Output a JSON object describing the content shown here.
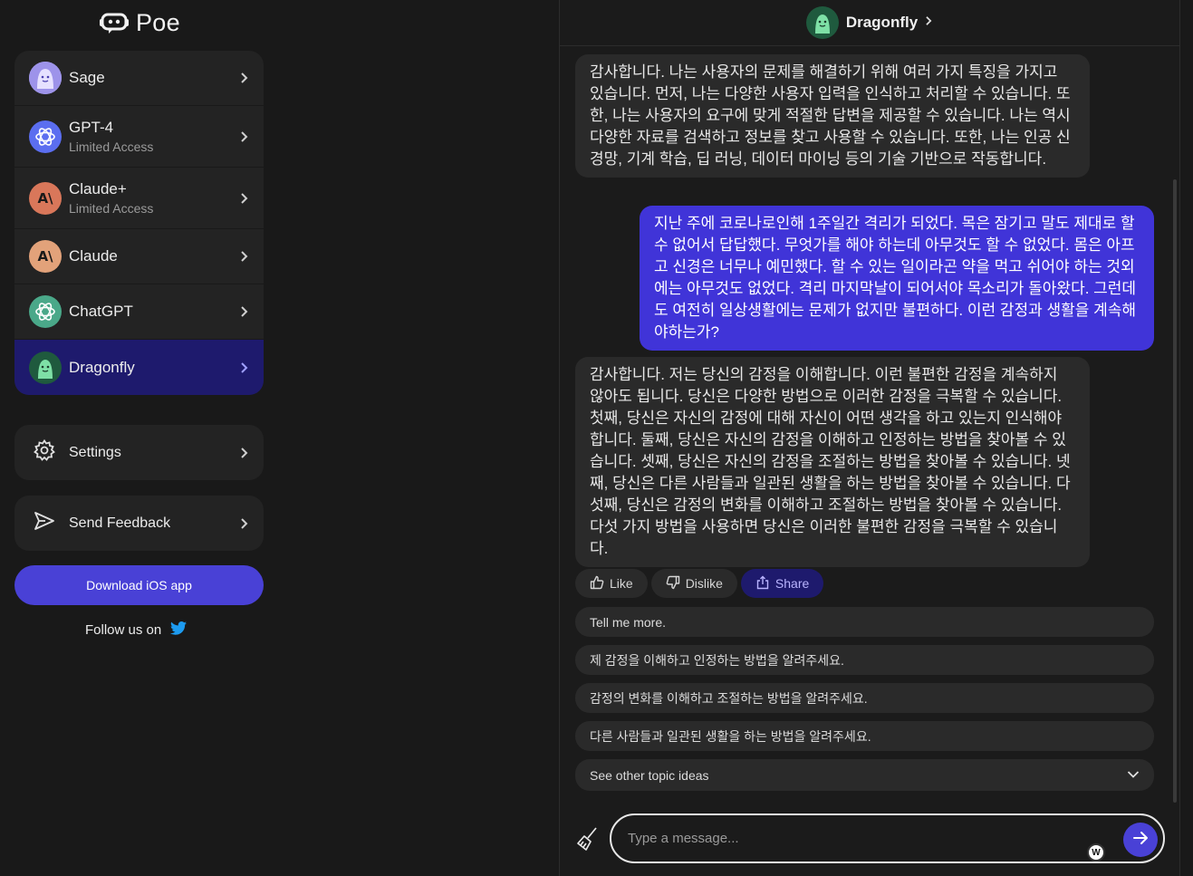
{
  "app": {
    "name": "Poe"
  },
  "sidebar": {
    "bots": [
      {
        "name": "Sage",
        "sub": ""
      },
      {
        "name": "GPT-4",
        "sub": "Limited Access"
      },
      {
        "name": "Claude+",
        "sub": "Limited Access"
      },
      {
        "name": "Claude",
        "sub": ""
      },
      {
        "name": "ChatGPT",
        "sub": ""
      },
      {
        "name": "Dragonfly",
        "sub": ""
      }
    ],
    "settings_label": "Settings",
    "feedback_label": "Send Feedback",
    "download_label": "Download iOS app",
    "follow_label": "Follow us on"
  },
  "chat": {
    "bot_name": "Dragonfly",
    "messages": [
      {
        "role": "bot",
        "text": "감사합니다. 나는 사용자의 문제를 해결하기 위해 여러 가지 특징을 가지고 있습니다. 먼저, 나는 다양한 사용자 입력을 인식하고 처리할 수 있습니다. 또한, 나는 사용자의 요구에 맞게 적절한 답변을 제공할 수 있습니다. 나는 역시 다양한 자료를 검색하고 정보를 찾고 사용할 수 있습니다. 또한, 나는 인공 신경망, 기계 학습, 딥 러닝, 데이터 마이닝 등의 기술 기반으로 작동합니다."
      },
      {
        "role": "user",
        "text": "지난 주에 코로나로인해 1주일간 격리가 되었다. 목은 잠기고 말도 제대로 할 수 없어서 답답했다. 무엇가를 해야 하는데 아무것도 할 수 없었다. 몸은 아프고 신경은 너무나 예민했다. 할 수 있는 일이라곤 약을 먹고 쉬어야 하는 것외에는 아무것도 없었다. 격리 마지막날이 되어서야 목소리가 돌아왔다. 그런데도 여전히 일상생활에는 문제가 없지만 불편하다. 이런 감정과 생활을 계속해야하는가?"
      },
      {
        "role": "bot",
        "text": "감사합니다. 저는 당신의 감정을 이해합니다. 이런 불편한 감정을 계속하지 않아도 됩니다. 당신은 다양한 방법으로 이러한 감정을 극복할 수 있습니다. 첫째, 당신은 자신의 감정에 대해 자신이 어떤 생각을 하고 있는지 인식해야 합니다. 둘째, 당신은 자신의 감정을 이해하고 인정하는 방법을 찾아볼 수 있습니다. 셋째, 당신은 자신의 감정을 조절하는 방법을 찾아볼 수 있습니다. 넷째, 당신은 다른 사람들과 일관된 생활을 하는 방법을 찾아볼 수 있습니다. 다섯째, 당신은 감정의 변화를 이해하고 조절하는 방법을 찾아볼 수 있습니다. 다섯 가지 방법을 사용하면 당신은 이러한 불편한 감정을 극복할 수 있습니다."
      }
    ],
    "actions": {
      "like": "Like",
      "dislike": "Dislike",
      "share": "Share"
    },
    "suggestions": [
      "Tell me more.",
      "제 감정을 이해하고 인정하는 방법을 알려주세요.",
      "감정의 변화를 이해하고 조절하는 방법을 알려주세요.",
      "다른 사람들과 일관된 생활을 하는 방법을 알려주세요."
    ],
    "other_topics": "See other topic ideas",
    "input_placeholder": "Type a message..."
  },
  "colors": {
    "accent": "#4941d6",
    "active_bot": "#1e1a6d",
    "user_bubble": "#4034d8"
  }
}
